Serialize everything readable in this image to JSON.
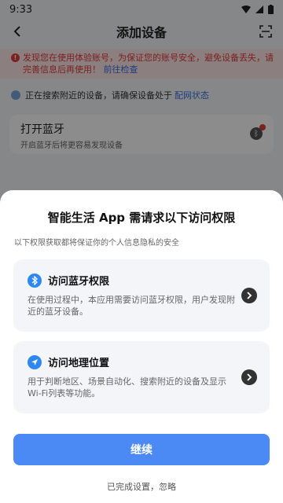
{
  "status": {
    "time": "9:33"
  },
  "header": {
    "title": "添加设备"
  },
  "warning": {
    "text": "发现您在使用体验账号，为保证您的账号安全，避免设备丢失，请完善信息后再使用！",
    "link": "前往检查"
  },
  "searching": {
    "text": "正在搜索附近的设备，请确保设备处于",
    "link": "配网状态"
  },
  "bluetooth_card": {
    "title": "打开蓝牙",
    "subtitle": "开启蓝牙后将更容易发现设备"
  },
  "sheet": {
    "title": "智能生活 App 需请求以下访问权限",
    "subtitle": "以下权限获取都将保证你的个人信息隐私的安全",
    "permissions": [
      {
        "title": "访问蓝牙权限",
        "desc": "在使用过程中，本应用需要访问蓝牙权限，用户发现附近的蓝牙设备。",
        "icon": "bluetooth-icon"
      },
      {
        "title": "访问地理位置",
        "desc": "用于判断地区、场景自动化、搜索附近的设备及显示 Wi-Fi列表等功能。",
        "icon": "location-icon"
      }
    ],
    "continue_label": "继续",
    "ignore_label": "已完成设置，忽略"
  },
  "colors": {
    "primary": "#4b89f4",
    "warning": "#e23b3b",
    "icon_blue": "#2d87f5"
  }
}
